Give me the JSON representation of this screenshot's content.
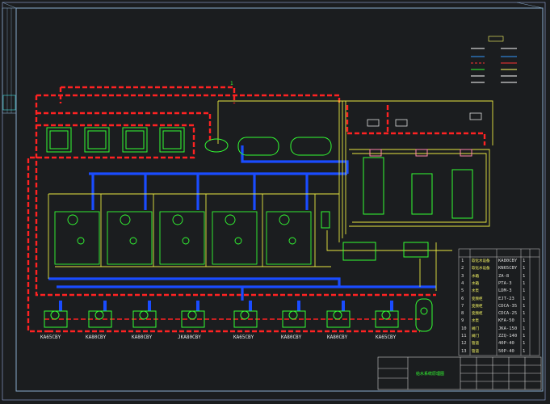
{
  "drawing": {
    "title_block_text": "给水系统原理图",
    "corner_marks": [
      "1"
    ],
    "pump_labels": [
      "KA65CBY",
      "KA80CBY",
      "KA80CBY",
      "JKA80CBY",
      "KA65CBY",
      "KA80CBY",
      "KA80CBY",
      "KA65CBY"
    ],
    "legend_lines": [
      "",
      "",
      " ",
      " ",
      " ",
      " "
    ],
    "equipment_table": {
      "rows": [
        {
          "no": "1",
          "name": "软化水设备",
          "model": "KA80CBY",
          "qty": "1"
        },
        {
          "no": "2",
          "name": "软化水设备",
          "model": "KN65CBY",
          "qty": "1"
        },
        {
          "no": "3",
          "name": "水箱",
          "model": "ZA-8",
          "qty": "1"
        },
        {
          "no": "4",
          "name": "水箱",
          "model": "PTA-3",
          "qty": "1"
        },
        {
          "no": "5",
          "name": "水泵",
          "model": "LDM-3",
          "qty": "1"
        },
        {
          "no": "6",
          "name": "变频柜",
          "model": "EJT-23",
          "qty": "1"
        },
        {
          "no": "7",
          "name": "变频柜",
          "model": "CDCA-35",
          "qty": "1"
        },
        {
          "no": "8",
          "name": "变频柜",
          "model": "CDCA-25",
          "qty": "1"
        },
        {
          "no": "9",
          "name": "水泵",
          "model": "KFA-50",
          "qty": "1"
        },
        {
          "no": "10",
          "name": "阀门",
          "model": "JKA-150",
          "qty": "1"
        },
        {
          "no": "11",
          "name": "阀门",
          "model": "ZZQ-140",
          "qty": "1"
        },
        {
          "no": "12",
          "name": "管道",
          "model": "40P-40",
          "qty": "1"
        },
        {
          "no": "13",
          "name": "管道",
          "model": "50P-40",
          "qty": "1"
        }
      ]
    }
  }
}
